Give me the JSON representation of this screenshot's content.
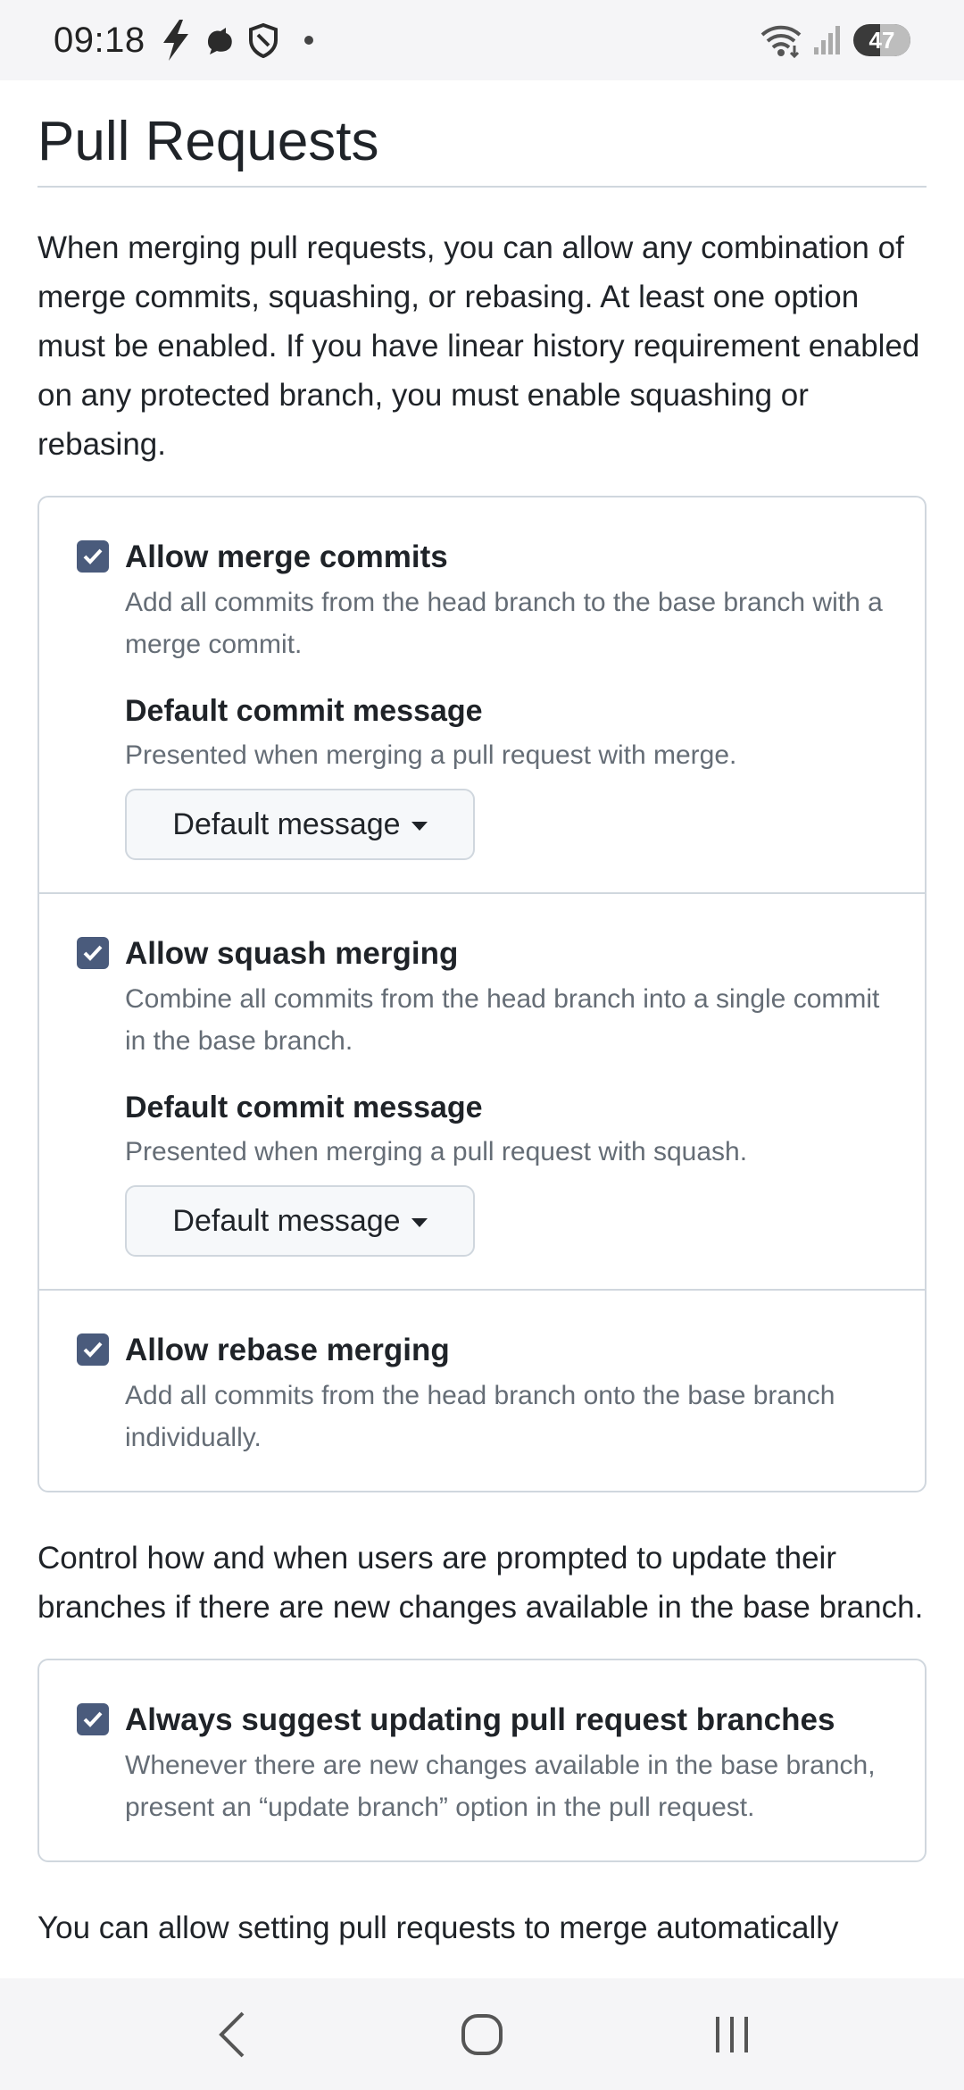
{
  "status_bar": {
    "time": "09:18",
    "battery": "47",
    "left_icons": [
      "bolt-icon",
      "bird-icon",
      "shield-icon"
    ],
    "right_icons": [
      "wifi-icon",
      "signal-icon",
      "battery-icon"
    ]
  },
  "page": {
    "title": "Pull Requests",
    "intro": "When merging pull requests, you can allow any combination of merge commits, squashing, or rebasing. At least one option must be enabled. If you have linear history requirement enabled on any protected branch, you must enable squashing or rebasing."
  },
  "merge_options": [
    {
      "label": "Allow merge commits",
      "checked": true,
      "description": "Add all commits from the head branch to the base branch with a merge commit.",
      "sub_title": "Default commit message",
      "sub_description": "Presented when merging a pull request with merge.",
      "dropdown_value": "Default message"
    },
    {
      "label": "Allow squash merging",
      "checked": true,
      "description": "Combine all commits from the head branch into a single commit in the base branch.",
      "sub_title": "Default commit message",
      "sub_description": "Presented when merging a pull request with squash.",
      "dropdown_value": "Default message"
    },
    {
      "label": "Allow rebase merging",
      "checked": true,
      "description": "Add all commits from the head branch onto the base branch individually."
    }
  ],
  "update_section": {
    "intro": "Control how and when users are prompted to update their branches if there are new changes available in the base branch.",
    "option": {
      "label": "Always suggest updating pull request branches",
      "checked": true,
      "description": "Whenever there are new changes available in the base branch, present an “update branch” option in the pull request."
    }
  },
  "auto_merge_teaser": "You can allow setting pull requests to merge automatically",
  "colors": {
    "checkbox": "#4a5b7c",
    "border": "#d0d7de",
    "muted_text": "#656d76",
    "text": "#1f2328"
  },
  "nav_bar": {
    "buttons": [
      "back-icon",
      "home-icon",
      "recents-icon"
    ]
  }
}
